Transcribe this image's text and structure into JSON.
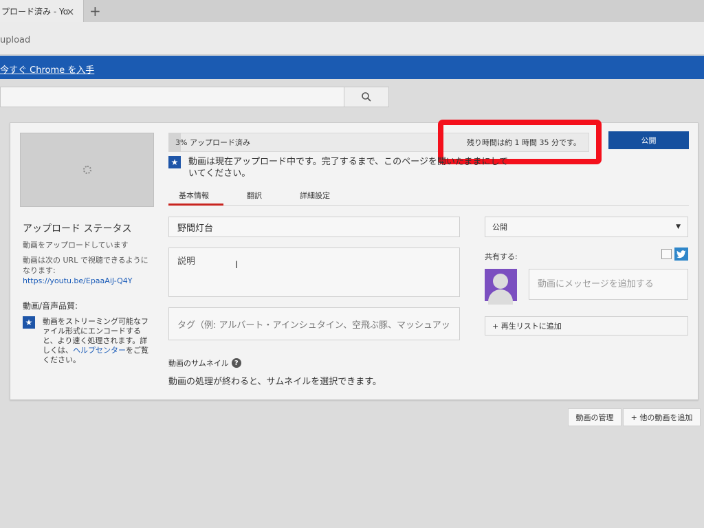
{
  "browser": {
    "tab_title": "プロード済み - Yo",
    "tab_close": "×",
    "new_tab": "+",
    "address_text": "upload",
    "banner_link": "今すぐ Chrome を入手"
  },
  "upload": {
    "progress_label": "3% アップロード済み",
    "progress_percent": 3,
    "remaining_label": "残り時間は約 1 時間 35 分です。",
    "publish_button": "公開",
    "notice": "動画は現在アップロード中です。完了するまで、このページを開いたままにして いてください。"
  },
  "sidebar": {
    "status_title": "アップロード ステータス",
    "status_text": "動画をアップロードしています",
    "url_prefix": "動画は次の URL で視聴できるようになります:",
    "url_link": "https://youtu.be/EpaaAiJ-Q4Y",
    "quality_title": "動画/音声品質:",
    "quality_text_before": "動画をストリーミング可能なファイル形式にエンコードすると、より速く処理されます。詳しくは、",
    "help_link": "ヘルプセンター",
    "quality_text_after": "をご覧ください。"
  },
  "tabs": {
    "basic": "基本情報",
    "translation": "翻訳",
    "advanced": "詳細設定"
  },
  "form": {
    "title_value": "野間灯台",
    "description_placeholder": "説明",
    "tags_placeholder": "タグ（例: アルバート・アインシュタイン、空飛ぶ豚、マッシュアッ",
    "thumbnail_title": "動画のサムネイル",
    "thumbnail_text": "動画の処理が終わると、サムネイルを選択できます。"
  },
  "right": {
    "privacy_value": "公開",
    "share_label": "共有する:",
    "message_placeholder": "動画にメッセージを追加する",
    "playlist_button": "+ 再生リストに追加"
  },
  "footer": {
    "manage_button": "動画の管理",
    "add_video_button": "+ 他の動画を追加"
  },
  "colors": {
    "accent_blue": "#15509f",
    "banner_blue": "#1b5bb2",
    "highlight_red": "#f4101c",
    "tab_active_red": "#c8241f"
  }
}
